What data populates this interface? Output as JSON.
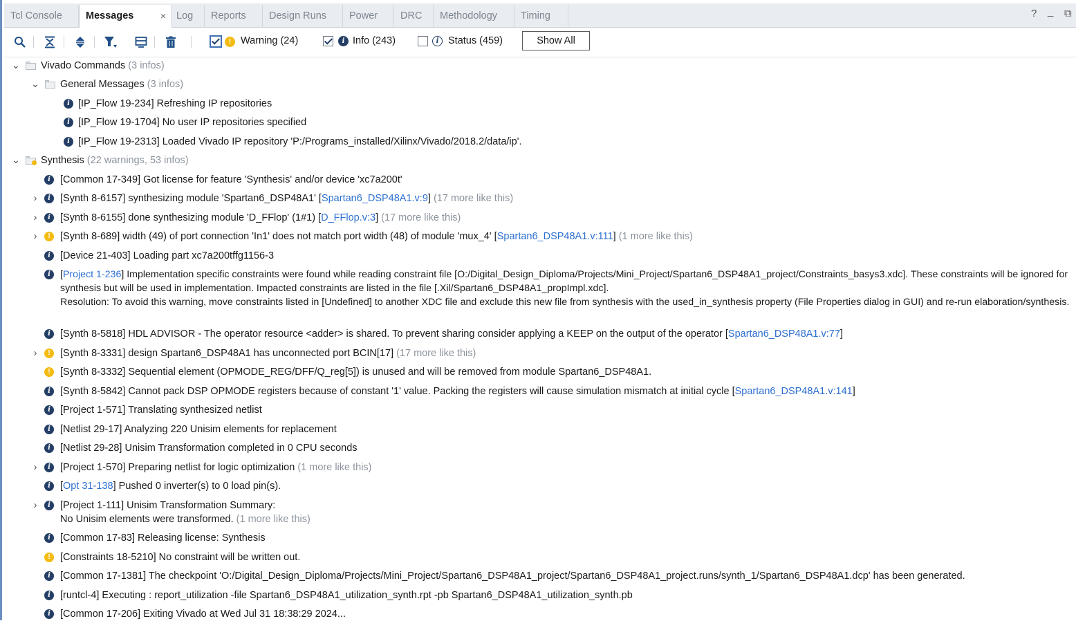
{
  "tabs": [
    {
      "label": "Tcl Console",
      "active": false
    },
    {
      "label": "Messages",
      "active": true,
      "closable": true
    },
    {
      "label": "Log",
      "active": false
    },
    {
      "label": "Reports",
      "active": false
    },
    {
      "label": "Design Runs",
      "active": false
    },
    {
      "label": "Power",
      "active": false
    },
    {
      "label": "DRC",
      "active": false
    },
    {
      "label": "Methodology",
      "active": false
    },
    {
      "label": "Timing",
      "active": false
    }
  ],
  "window_controls": {
    "help": "?",
    "minimize": "_",
    "restore": "⧉"
  },
  "toolbar": {
    "icons": [
      "search-icon",
      "collapse-all-icon",
      "expand-all-icon",
      "filter-icon",
      "group-icon",
      "delete-icon"
    ],
    "filters": {
      "warning": {
        "label": "Warning (24)",
        "checked": true
      },
      "info": {
        "label": "Info (243)",
        "checked": true
      },
      "status": {
        "label": "Status (459)",
        "checked": false
      }
    },
    "show_all": "Show All"
  },
  "colors": {
    "info_icon": "#243e66",
    "warning_icon": "#f4bb12",
    "link": "#2c6fd0",
    "dim": "#8c939c"
  },
  "groups": {
    "vivado": {
      "label": "Vivado Commands",
      "count": "(3 infos)"
    },
    "general": {
      "label": "General Messages",
      "count": "(3 infos)"
    },
    "synthesis": {
      "label": "Synthesis",
      "count": "(22 warnings, 53 infos)"
    }
  },
  "general_messages": [
    "[IP_Flow 19-234] Refreshing IP repositories",
    "[IP_Flow 19-1704] No user IP repositories specified",
    "[IP_Flow 19-2313] Loaded Vivado IP repository 'P:/Programs_installed/Xilinx/Vivado/2018.2/data/ip'."
  ],
  "synth": {
    "m1": {
      "text": "[Common 17-349] Got license for feature 'Synthesis' and/or device 'xc7a200t'"
    },
    "m2": {
      "text": "[Synth 8-6157] synthesizing module 'Spartan6_DSP48A1' [",
      "link": "Spartan6_DSP48A1.v:9",
      "end": "]",
      "more": "(17 more like this)"
    },
    "m3": {
      "text": "[Synth 8-6155] done synthesizing module 'D_FFlop' (1#1) [",
      "link": "D_FFlop.v:3",
      "end": "]",
      "more": "(17 more like this)"
    },
    "m4": {
      "text": "[Synth 8-689] width (49) of port connection 'In1' does not match port width (48) of module 'mux_4' [",
      "link": "Spartan6_DSP48A1.v:111",
      "end": "]",
      "more": "(1 more like this)"
    },
    "m5": {
      "text": "[Device 21-403] Loading part xc7a200tffg1156-3"
    },
    "m6": {
      "pre": "[",
      "link": "Project 1-236",
      "text": "] Implementation specific constraints were found while reading constraint file [O:/Digital_Design_Diploma/Projects/Mini_Project/Spartan6_DSP48A1_project/Constraints_basys3.xdc]. These constraints will be ignored for synthesis but will be used in implementation. Impacted constraints are listed in the file [.Xil/Spartan6_DSP48A1_propImpl.xdc].",
      "resolution": "Resolution: To avoid this warning, move constraints listed in [Undefined] to another XDC file and exclude this new file from synthesis with the used_in_synthesis property (File Properties dialog in GUI) and re-run elaboration/synthesis."
    },
    "m7": {
      "text": "[Synth 8-5818] HDL ADVISOR - The operator resource <adder> is shared. To prevent sharing consider applying a KEEP on the output of the operator [",
      "link": "Spartan6_DSP48A1.v:77",
      "end": "]"
    },
    "m8": {
      "text": "[Synth 8-3331] design Spartan6_DSP48A1 has unconnected port BCIN[17]",
      "more": "(17 more like this)"
    },
    "m9": {
      "text": "[Synth 8-3332] Sequential element (OPMODE_REG/DFF/Q_reg[5]) is unused and will be removed from module Spartan6_DSP48A1."
    },
    "m10": {
      "text": "[Synth 8-5842] Cannot pack DSP OPMODE registers because of constant '1' value. Packing the registers will cause simulation mismatch at initial cycle [",
      "link": "Spartan6_DSP48A1.v:141",
      "end": "]"
    },
    "m11": {
      "text": "[Project 1-571] Translating synthesized netlist"
    },
    "m12": {
      "text": "[Netlist 29-17] Analyzing 220 Unisim elements for replacement"
    },
    "m13": {
      "text": "[Netlist 29-28] Unisim Transformation completed in 0 CPU seconds"
    },
    "m14": {
      "text": "[Project 1-570] Preparing netlist for logic optimization",
      "more": "(1 more like this)"
    },
    "m15": {
      "pre": "[",
      "link": "Opt 31-138",
      "text": "] Pushed 0 inverter(s) to 0 load pin(s)."
    },
    "m16": {
      "text": "[Project 1-111] Unisim Transformation Summary:",
      "line2": "No Unisim elements were transformed.",
      "more": "(1 more like this)"
    },
    "m17": {
      "text": "[Common 17-83] Releasing license: Synthesis"
    },
    "m18": {
      "text": "[Constraints 18-5210] No constraint will be written out."
    },
    "m19": {
      "text": "[Common 17-1381] The checkpoint 'O:/Digital_Design_Diploma/Projects/Mini_Project/Spartan6_DSP48A1_project/Spartan6_DSP48A1_project.runs/synth_1/Spartan6_DSP48A1.dcp' has been generated."
    },
    "m20": {
      "text": "[runtcl-4] Executing : report_utilization -file Spartan6_DSP48A1_utilization_synth.rpt -pb Spartan6_DSP48A1_utilization_synth.pb"
    },
    "m21": {
      "text": "[Common 17-206] Exiting Vivado at Wed Jul 31 18:38:29 2024..."
    }
  }
}
